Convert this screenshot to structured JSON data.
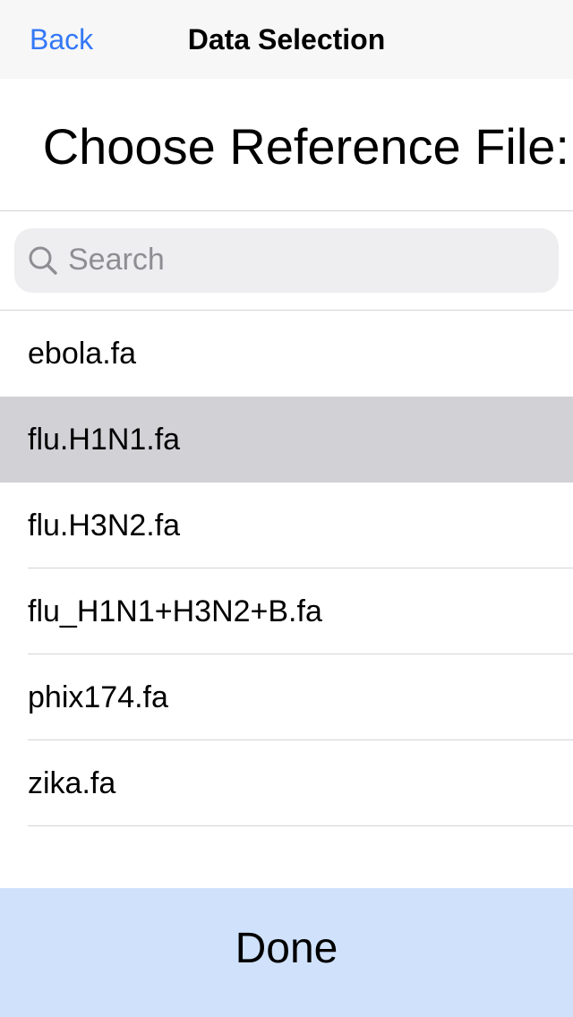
{
  "nav": {
    "back_label": "Back",
    "title": "Data Selection"
  },
  "heading": "Choose Reference File:",
  "search": {
    "placeholder": "Search",
    "value": ""
  },
  "files": [
    {
      "label": "ebola.fa",
      "selected": false
    },
    {
      "label": "flu.H1N1.fa",
      "selected": true
    },
    {
      "label": "flu.H3N2.fa",
      "selected": false
    },
    {
      "label": "flu_H1N1+H3N2+B.fa",
      "selected": false
    },
    {
      "label": "phix174.fa",
      "selected": false
    },
    {
      "label": "zika.fa",
      "selected": false
    }
  ],
  "done_label": "Done",
  "colors": {
    "accent": "#3478f6",
    "selected_row": "#d1d1d6",
    "done_bar": "#d0e2fb",
    "search_bg": "#eeeef0"
  },
  "icons": {
    "search": "magnifying-glass"
  }
}
